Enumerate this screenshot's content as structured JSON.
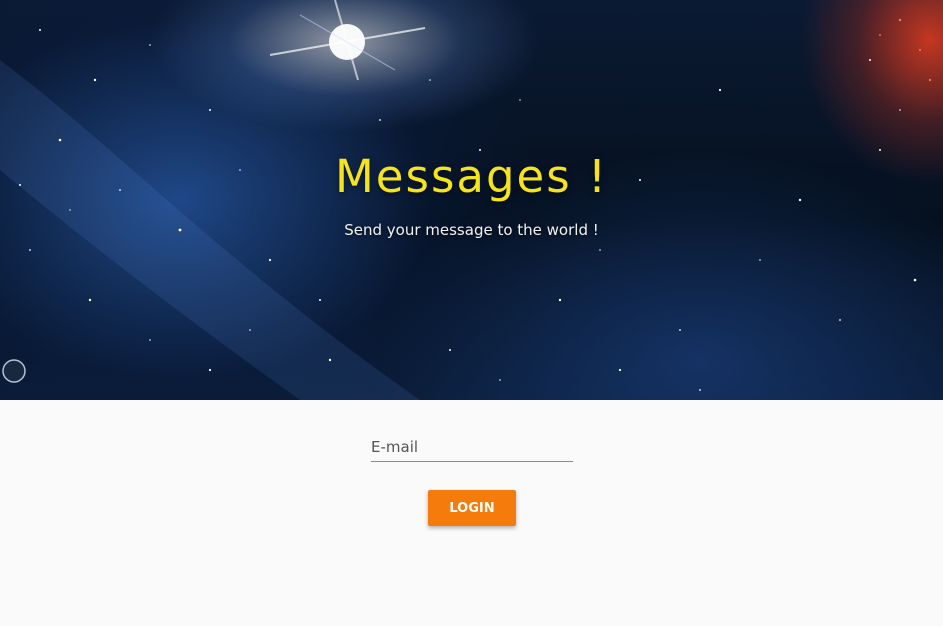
{
  "hero": {
    "title": "Messages !",
    "subtitle": "Send your message to the world !",
    "title_color": "#f5e31b"
  },
  "login": {
    "email_placeholder": "E-mail",
    "email_value": "",
    "button_label": "LOGIN",
    "button_color": "#f57c0c"
  }
}
